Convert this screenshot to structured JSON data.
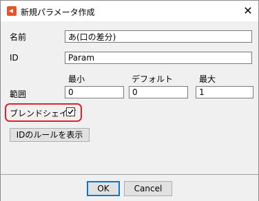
{
  "window": {
    "title": "新規パラメータ作成",
    "close_glyph": "✕"
  },
  "form": {
    "name_label": "名前",
    "name_value": "あ(口の差分)",
    "id_label": "ID",
    "id_value": "Param",
    "range": {
      "label": "範囲",
      "min_label": "最小",
      "min_value": "0",
      "default_label": "デフォルト",
      "default_value": "0",
      "max_label": "最大",
      "max_value": "1"
    },
    "blend_shape_label": "ブレンドシェイプ",
    "blend_shape_checked": true,
    "id_rules_button": "IDのルールを表示"
  },
  "footer": {
    "ok_label": "OK",
    "cancel_label": "Cancel"
  },
  "colors": {
    "highlight": "#e0202a",
    "app_icon": "#e8542a",
    "default_button_border": "#0078d7"
  },
  "icons": {
    "app": "app-logo-icon",
    "close": "close-icon",
    "check": "checkmark-icon"
  }
}
